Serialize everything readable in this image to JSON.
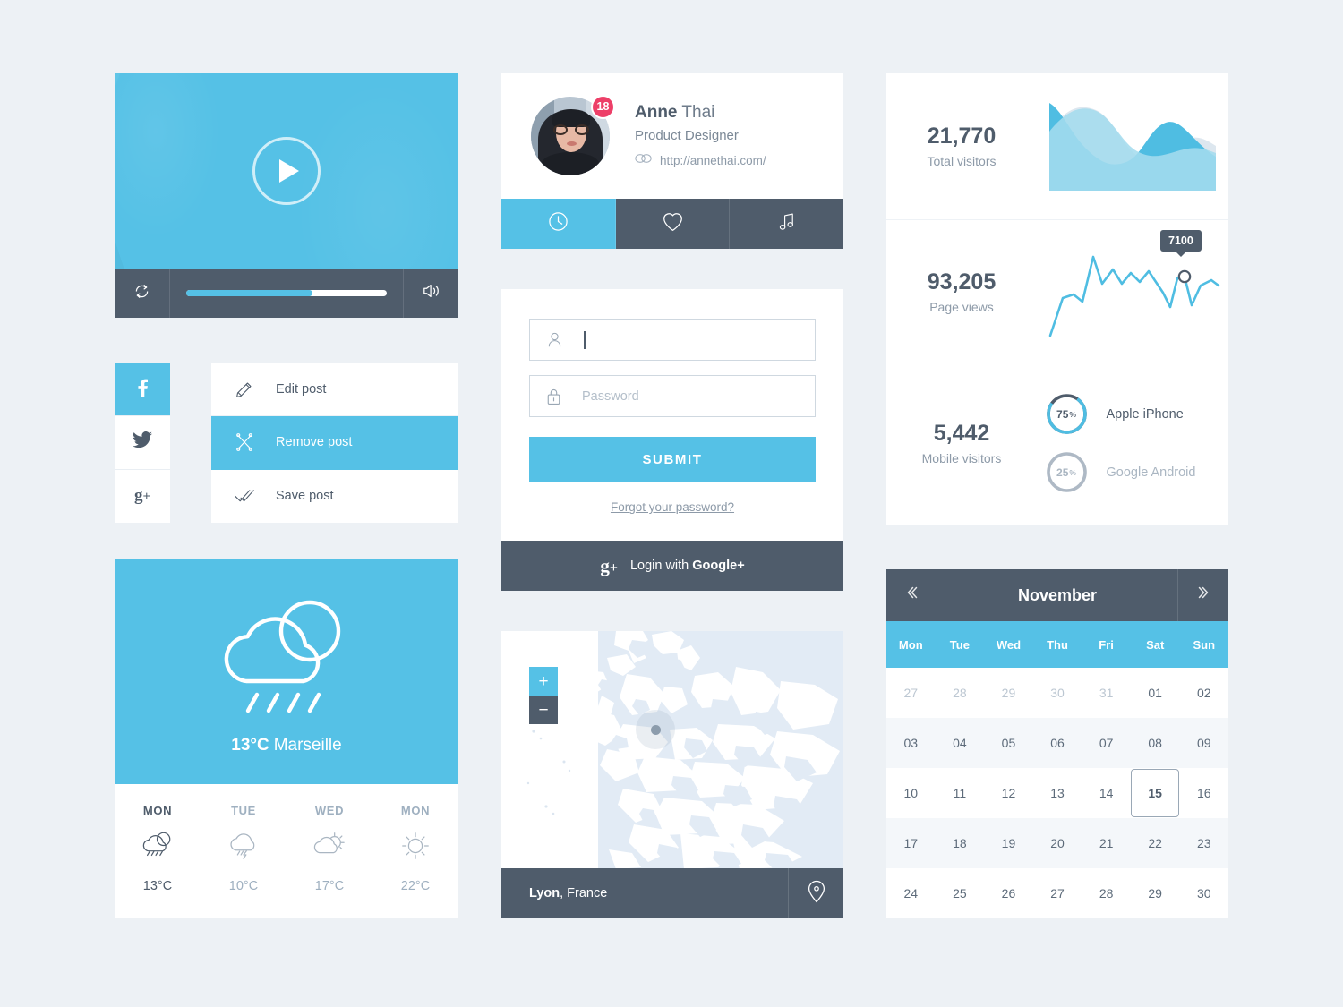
{
  "theme": {
    "page_bg": "#edf1f5",
    "primary": "#55c1e6",
    "dark": "#4f5c6b",
    "badge": "#ed3f68",
    "muted_text": "#8d9aa8"
  },
  "video_player": {
    "name": "video-player",
    "play_icon": "play-icon",
    "loop_icon": "loop-icon",
    "volume_icon": "volume-icon",
    "progress_percent": 63
  },
  "social": {
    "items": [
      {
        "icon": "facebook-icon",
        "label": "f",
        "active": true
      },
      {
        "icon": "twitter-icon",
        "label": "t",
        "active": false
      },
      {
        "icon": "google-plus-icon",
        "label": "g+",
        "active": false
      }
    ]
  },
  "post_menu": {
    "items": [
      {
        "label": "Edit post",
        "icon": "pencil-icon",
        "active": false
      },
      {
        "label": "Remove post",
        "icon": "scissors-icon",
        "active": true
      },
      {
        "label": "Save post",
        "icon": "double-check-icon",
        "active": false
      }
    ]
  },
  "weather": {
    "icon": "cloud-rain-sun-icon",
    "temperature": "13°C",
    "city": "Marseille",
    "forecast": [
      {
        "day": "MON",
        "icon": "cloud-sun-rain-icon",
        "temp": "13°C",
        "today": true
      },
      {
        "day": "TUE",
        "icon": "cloud-storm-icon",
        "temp": "10°C",
        "today": false
      },
      {
        "day": "WED",
        "icon": "cloud-sun-icon",
        "temp": "17°C",
        "today": false
      },
      {
        "day": "MON",
        "icon": "sun-icon",
        "temp": "22°C",
        "today": false
      }
    ]
  },
  "profile": {
    "badge_count": "18",
    "first_name": "Anne",
    "last_name": " Thai",
    "role": "Product Designer",
    "link_icon": "link-icon",
    "website": "http://annethai.com/",
    "tabs": [
      {
        "icon": "clock-icon",
        "active": true
      },
      {
        "icon": "heart-icon",
        "active": false
      },
      {
        "icon": "music-note-icon",
        "active": false
      }
    ]
  },
  "login": {
    "username": {
      "icon": "user-icon",
      "value": "",
      "placeholder": ""
    },
    "password": {
      "icon": "lock-icon",
      "value": "",
      "placeholder": "Password"
    },
    "submit_label": "SUBMIT",
    "forgot_label": "Forgot your password?",
    "google_icon": "google-plus-icon",
    "google_prefix": "Login with ",
    "google_brand": "Google+"
  },
  "map": {
    "zoom_in_label": "+",
    "zoom_out_label": "−",
    "city": "Lyon",
    "country": ", France",
    "pin_icon": "map-pin-icon"
  },
  "stats": {
    "rows": [
      {
        "number": "21,770",
        "label": "Total visitors"
      },
      {
        "number": "93,205",
        "label": "Page views"
      },
      {
        "number": "5,442",
        "label": "Mobile visitors"
      }
    ],
    "tooltip_value": "7100",
    "devices": [
      {
        "percent": "75",
        "unit": "%",
        "label": "Apple iPhone",
        "muted": false
      },
      {
        "percent": "25",
        "unit": "%",
        "label": "Google Android",
        "muted": true
      }
    ]
  },
  "calendar": {
    "prev_icon": "double-chevron-left-icon",
    "next_icon": "double-chevron-right-icon",
    "month": "November",
    "dow": [
      "Mon",
      "Tue",
      "Wed",
      "Thu",
      "Fri",
      "Sat",
      "Sun"
    ],
    "weeks": [
      [
        {
          "d": "27",
          "out": true
        },
        {
          "d": "28",
          "out": true
        },
        {
          "d": "29",
          "out": true
        },
        {
          "d": "30",
          "out": true
        },
        {
          "d": "31",
          "out": true
        },
        {
          "d": "01",
          "out": false
        },
        {
          "d": "02",
          "out": false
        }
      ],
      [
        {
          "d": "03"
        },
        {
          "d": "04"
        },
        {
          "d": "05"
        },
        {
          "d": "06"
        },
        {
          "d": "07"
        },
        {
          "d": "08"
        },
        {
          "d": "09"
        }
      ],
      [
        {
          "d": "10"
        },
        {
          "d": "11"
        },
        {
          "d": "12"
        },
        {
          "d": "13"
        },
        {
          "d": "14"
        },
        {
          "d": "15",
          "selected": true
        },
        {
          "d": "16"
        }
      ],
      [
        {
          "d": "17"
        },
        {
          "d": "18"
        },
        {
          "d": "19"
        },
        {
          "d": "20"
        },
        {
          "d": "21"
        },
        {
          "d": "22"
        },
        {
          "d": "23"
        }
      ],
      [
        {
          "d": "24"
        },
        {
          "d": "25"
        },
        {
          "d": "26"
        },
        {
          "d": "27"
        },
        {
          "d": "28"
        },
        {
          "d": "29"
        },
        {
          "d": "30"
        }
      ]
    ]
  },
  "chart_data": [
    {
      "type": "area",
      "title": "Total visitors",
      "total": 21770,
      "series": [
        {
          "name": "layer-back",
          "color": "#dde7ef",
          "values": [
            62,
            78,
            92,
            86,
            62,
            44,
            40,
            48,
            56,
            52,
            46,
            42
          ]
        },
        {
          "name": "layer-mid",
          "color": "#4fbde2",
          "values": [
            96,
            84,
            58,
            40,
            34,
            40,
            58,
            74,
            78,
            62,
            38,
            30
          ]
        },
        {
          "name": "layer-front",
          "color": "#a4dcee",
          "values": [
            62,
            80,
            92,
            88,
            70,
            52,
            46,
            44,
            48,
            50,
            44,
            40
          ]
        }
      ],
      "grid": false,
      "legend": false
    },
    {
      "type": "line",
      "title": "Page views",
      "total": 93205,
      "color": "#4fbde2",
      "values": [
        4,
        34,
        46,
        40,
        92,
        62,
        78,
        56,
        72,
        62,
        78,
        64,
        46,
        20,
        56,
        88,
        22,
        50,
        66,
        58
      ],
      "annotation": {
        "index": 15,
        "label": "7100"
      },
      "grid": false,
      "legend": false
    },
    {
      "type": "pie",
      "title": "Mobile visitors",
      "total": 5442,
      "categories": [
        "Apple iPhone",
        "Google Android"
      ],
      "values": [
        75,
        25
      ],
      "colors": [
        "#4fbde2",
        "#aab6c2"
      ],
      "grid": false,
      "legend": true,
      "legend_position": "right"
    }
  ]
}
